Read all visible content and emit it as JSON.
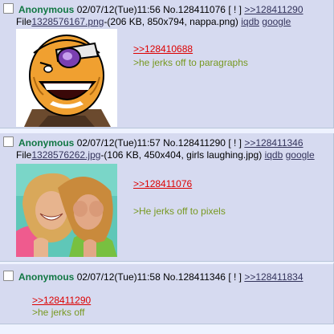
{
  "posts": [
    {
      "name": "Anonymous",
      "datetime": "02/07/12(Tue)11:56",
      "number": "No.128411076",
      "report": "[ ! ]",
      "backlink": ">>128411290",
      "file_prefix": "File",
      "file_link": "1328576167.png",
      "file_info": "-(206 KB, 850x794, nappa.png)",
      "iqdb": "iqdb",
      "google": "google",
      "quote": ">>128410688",
      "greentext": ">he jerks off to paragraphs",
      "image_icon": "bald-saiyan-face-image"
    },
    {
      "name": "Anonymous",
      "datetime": "02/07/12(Tue)11:57",
      "number": "No.128411290",
      "report": "[ ! ]",
      "backlink": ">>128411346",
      "file_prefix": "File",
      "file_link": "1328576262.jpg",
      "file_info": "-(106 KB, 450x404, girls laughing.jpg)",
      "iqdb": "iqdb",
      "google": "google",
      "quote": ">>128411076",
      "greentext": ">He jerks off to pixels",
      "image_icon": "girls-laughing-photo"
    },
    {
      "name": "Anonymous",
      "datetime": "02/07/12(Tue)11:58",
      "number": "No.128411346",
      "report": "[ ! ]",
      "backlink": ">>128411834",
      "quote": ">>128411290",
      "greentext": ">he jerks off"
    }
  ],
  "colors": {
    "post_bg": "#d6daf0",
    "page_bg": "#eef2ff",
    "name": "#117743",
    "quote": "#dd0000",
    "greentext": "#789922",
    "link": "#34345c"
  }
}
